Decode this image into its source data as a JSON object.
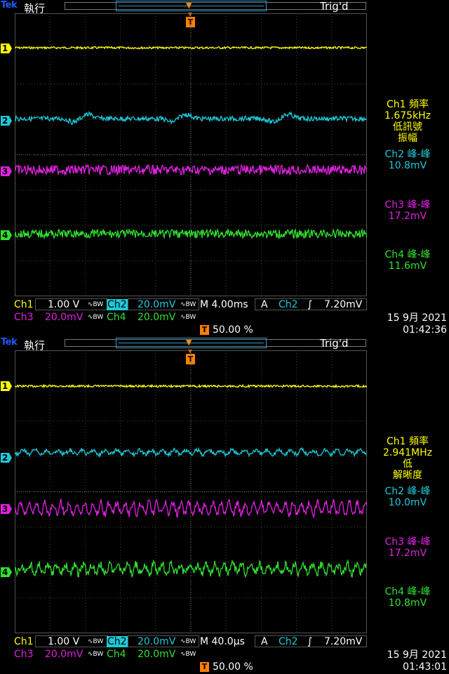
{
  "screens": [
    {
      "brand": "Tek",
      "run_state": "執行",
      "trig_state": "Trig'd",
      "trigger_marker": "T",
      "channel_tags": [
        "1",
        "2",
        "3",
        "4"
      ],
      "measurements": [
        {
          "lines": [
            "Ch1 頻率",
            "1.675kHz",
            "低訊號",
            "振幅"
          ],
          "color": "#ffff00"
        },
        {
          "lines": [
            "Ch2 峰-峰",
            "10.8mV"
          ],
          "color": "#1ec8d8"
        },
        {
          "lines": [
            "Ch3 峰-峰",
            "17.2mV"
          ],
          "color": "#e020e0"
        },
        {
          "lines": [
            "Ch4 峰-峰",
            "11.6mV"
          ],
          "color": "#30e030"
        }
      ],
      "ch1_label": "Ch1",
      "ch1_scale": "1.00 V",
      "ch2_label": "Ch2",
      "ch2_scale": "20.0mV",
      "ch3_label": "Ch3",
      "ch3_scale": "20.0mV",
      "ch4_label": "Ch4",
      "ch4_scale": "20.0mV",
      "coupling": "∿BW",
      "timebase": "M 4.00ms",
      "trigger_mode": "A",
      "trigger_source": "Ch2",
      "trigger_slope": "∫",
      "trigger_level": "7.20mV",
      "trigger_position": "50.00 %",
      "date": "15 9月  2021",
      "time": "01:42:36"
    },
    {
      "brand": "Tek",
      "run_state": "執行",
      "trig_state": "Trig'd",
      "trigger_marker": "T",
      "channel_tags": [
        "1",
        "2",
        "3",
        "4"
      ],
      "measurements": [
        {
          "lines": [
            "Ch1 頻率",
            "2.941MHz",
            "低",
            "解晰度"
          ],
          "color": "#ffff00"
        },
        {
          "lines": [
            "Ch2 峰-峰",
            "10.0mV"
          ],
          "color": "#1ec8d8"
        },
        {
          "lines": [
            "Ch3 峰-峰",
            "17.2mV"
          ],
          "color": "#e020e0"
        },
        {
          "lines": [
            "Ch4 峰-峰",
            "10.8mV"
          ],
          "color": "#30e030"
        }
      ],
      "ch1_label": "Ch1",
      "ch1_scale": "1.00 V",
      "ch2_label": "Ch2",
      "ch2_scale": "20.0mV",
      "ch3_label": "Ch3",
      "ch3_scale": "20.0mV",
      "ch4_label": "Ch4",
      "ch4_scale": "20.0mV",
      "coupling": "∿BW",
      "timebase": "M 40.0µs",
      "trigger_mode": "A",
      "trigger_source": "Ch2",
      "trigger_slope": "∫",
      "trigger_level": "7.20mV",
      "trigger_position": "50.00 %",
      "date": "15 9月  2021",
      "time": "01:43:01"
    }
  ],
  "colors": {
    "ch1": "#ffff00",
    "ch2": "#1ec8d8",
    "ch3": "#e020e0",
    "ch4": "#30e030",
    "trigger": "#ff8000"
  }
}
